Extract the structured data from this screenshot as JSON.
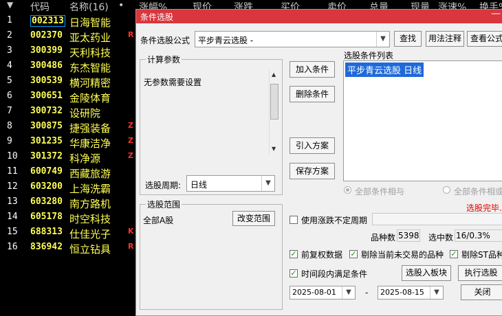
{
  "stock_list": {
    "headers": [
      "代码",
      "名称(16)",
      "•",
      "涨幅%",
      "现价",
      "涨跌",
      "买价",
      "卖价",
      "总量",
      "现量",
      "涨速%",
      "换手%"
    ],
    "rows": [
      {
        "idx": "1",
        "code": "002313",
        "name": "日海智能",
        "flag": ""
      },
      {
        "idx": "2",
        "code": "002370",
        "name": "亚太药业",
        "flag": "R"
      },
      {
        "idx": "3",
        "code": "300399",
        "name": "天利科技",
        "flag": ""
      },
      {
        "idx": "4",
        "code": "300486",
        "name": "东杰智能",
        "flag": ""
      },
      {
        "idx": "5",
        "code": "300539",
        "name": "横河精密",
        "flag": ""
      },
      {
        "idx": "6",
        "code": "300651",
        "name": "金陵体育",
        "flag": ""
      },
      {
        "idx": "7",
        "code": "300732",
        "name": "设研院",
        "flag": ""
      },
      {
        "idx": "8",
        "code": "300875",
        "name": "捷强装备",
        "flag": "Z"
      },
      {
        "idx": "9",
        "code": "301235",
        "name": "华康洁净",
        "flag": "Z"
      },
      {
        "idx": "10",
        "code": "301372",
        "name": "科净源",
        "flag": "Z"
      },
      {
        "idx": "11",
        "code": "600749",
        "name": "西藏旅游",
        "flag": ""
      },
      {
        "idx": "12",
        "code": "603200",
        "name": "上海洗霸",
        "flag": ""
      },
      {
        "idx": "13",
        "code": "603280",
        "name": "南方路机",
        "flag": ""
      },
      {
        "idx": "14",
        "code": "605178",
        "name": "时空科技",
        "flag": ""
      },
      {
        "idx": "15",
        "code": "688313",
        "name": "仕佳光子",
        "flag": "K"
      },
      {
        "idx": "16",
        "code": "836942",
        "name": "恒立钻具",
        "flag": "R"
      }
    ]
  },
  "dialog": {
    "title": "条件选股",
    "minimize": "—",
    "formula_label": "条件选股公式",
    "formula_value": "平步青云选股 -",
    "find_btn": "查找",
    "usage_btn": "用法注释",
    "view_btn": "查看公式",
    "params_caption": "计算参数",
    "params_text": "无参数需要设置",
    "add_btn": "加入条件",
    "delete_btn": "删除条件",
    "import_btn": "引入方案",
    "save_btn": "保存方案",
    "cond_list_label": "选股条件列表",
    "cond_list_items": [
      "平步青云选股  日线"
    ],
    "radio_all_and": "全部条件相与",
    "radio_all_or": "全部条件相或",
    "status": "选股完毕.",
    "period_label": "选股周期:",
    "period_value": "日线",
    "range_caption": "选股范围",
    "range_value": "全部A股",
    "change_range_btn": "改变范围",
    "use_irregular_label": "使用涨跌不定周期",
    "count_label": "品种数",
    "count_value": "5398",
    "selected_label": "选中数",
    "selected_value": "16/0.3%",
    "pre_adjust_label": "前复权数据",
    "exclude_untraded_label": "剔除当前未交易的品种",
    "exclude_st_label": "剔除ST品种",
    "time_range_label": "时间段内满足条件",
    "select_to_board_btn": "选股入板块",
    "execute_btn": "执行选股",
    "close_btn": "关闭",
    "date_from": "2025-08-01",
    "date_to": "2025-08-15",
    "date_sep": "-"
  },
  "colors": {
    "accent": "#d9363e",
    "code": "#ffff54",
    "flag": "#ff3030",
    "selection": "#1f6ad9"
  }
}
